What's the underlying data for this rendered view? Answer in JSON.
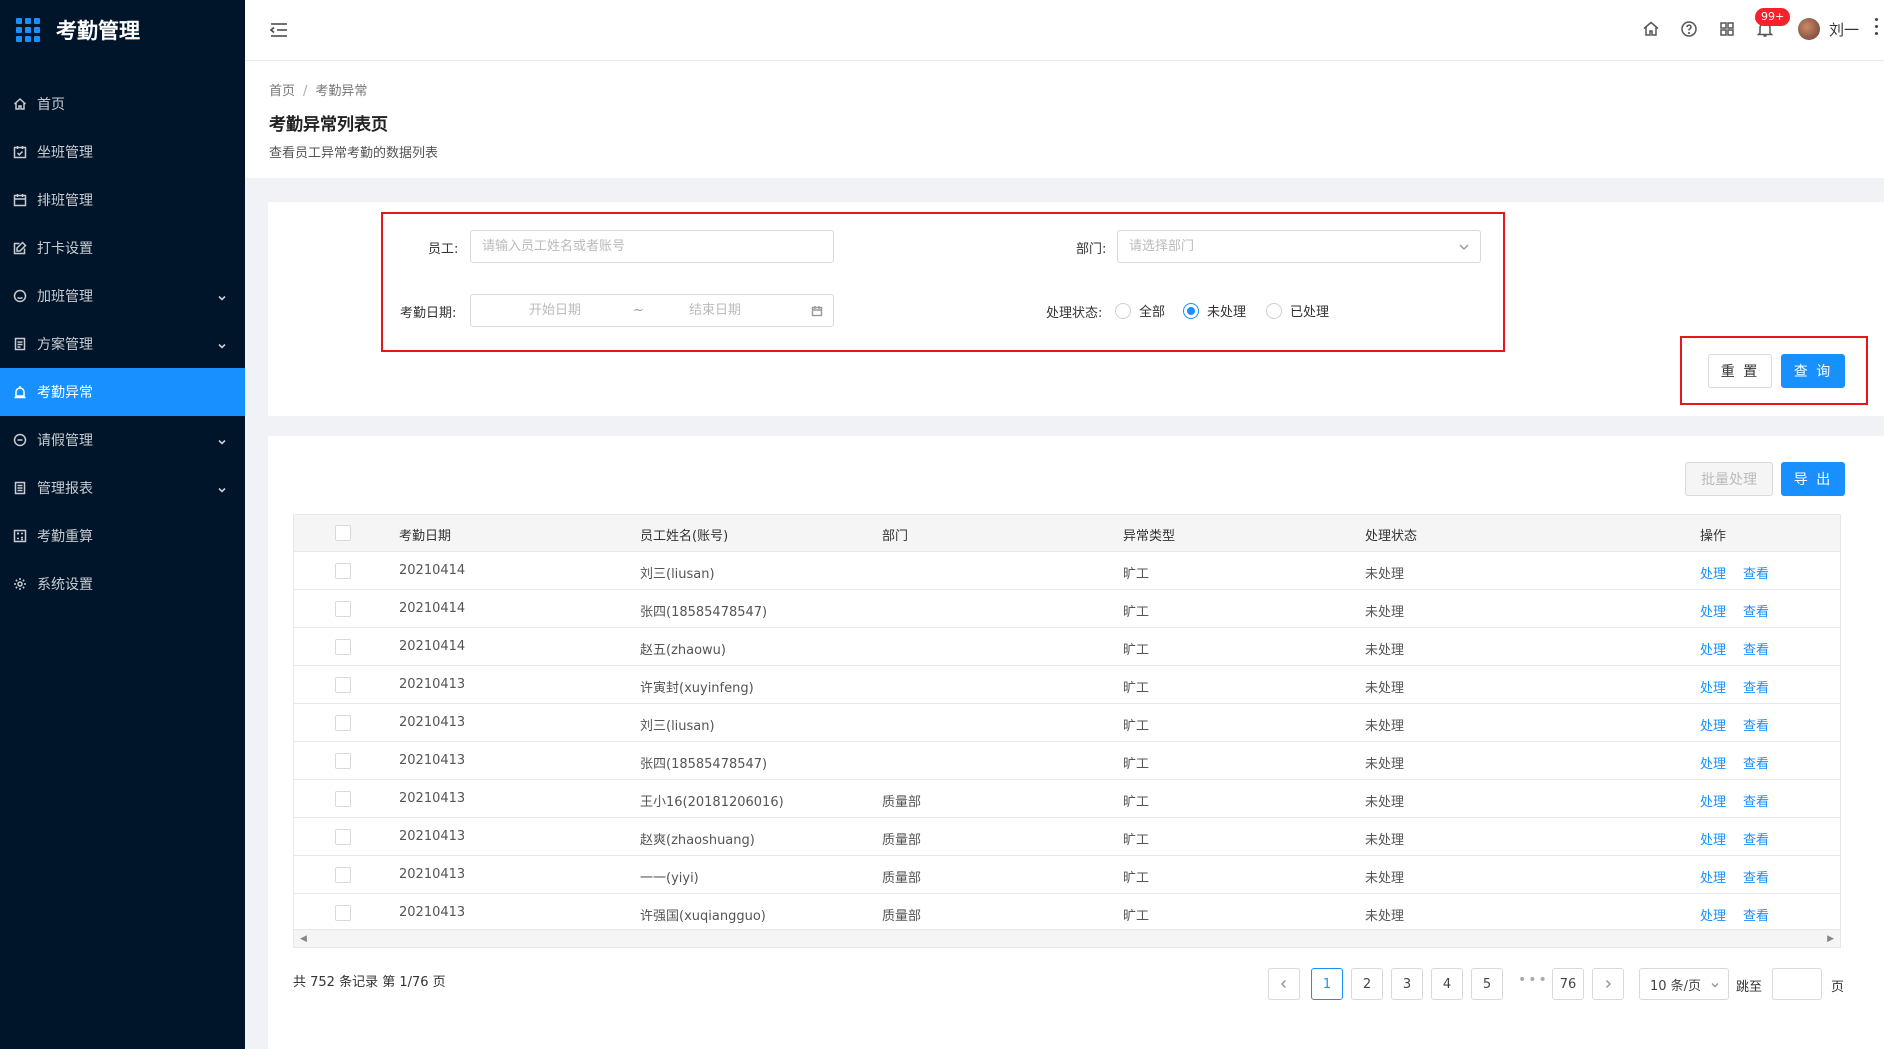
{
  "app": {
    "title": "考勤管理"
  },
  "sidebar": {
    "items": [
      {
        "label": "首页",
        "icon": "home-icon",
        "has_caret": false,
        "active": false
      },
      {
        "label": "坐班管理",
        "icon": "calendar-check-icon",
        "has_caret": false,
        "active": false
      },
      {
        "label": "排班管理",
        "icon": "calendar-icon",
        "has_caret": false,
        "active": false
      },
      {
        "label": "打卡设置",
        "icon": "edit-icon",
        "has_caret": false,
        "active": false
      },
      {
        "label": "加班管理",
        "icon": "clock-circle-icon",
        "has_caret": true,
        "active": false
      },
      {
        "label": "方案管理",
        "icon": "file-icon",
        "has_caret": true,
        "active": false
      },
      {
        "label": "考勤异常",
        "icon": "alert-icon",
        "has_caret": false,
        "active": true
      },
      {
        "label": "请假管理",
        "icon": "minus-circle-icon",
        "has_caret": true,
        "active": false
      },
      {
        "label": "管理报表",
        "icon": "report-icon",
        "has_caret": true,
        "active": false
      },
      {
        "label": "考勤重算",
        "icon": "calculator-icon",
        "has_caret": false,
        "active": false
      },
      {
        "label": "系统设置",
        "icon": "settings-icon",
        "has_caret": false,
        "active": false
      }
    ]
  },
  "header": {
    "badge": "99+",
    "user_name": "刘一"
  },
  "breadcrumb": {
    "home": "首页",
    "sep": "/",
    "current": "考勤异常"
  },
  "page": {
    "title": "考勤异常列表页",
    "description": "查看员工异常考勤的数据列表"
  },
  "filter": {
    "employee_label": "员工:",
    "employee_placeholder": "请输入员工姓名或者账号",
    "department_label": "部门:",
    "department_placeholder": "请选择部门",
    "date_label": "考勤日期:",
    "start_placeholder": "开始日期",
    "range_sep": "~",
    "end_placeholder": "结束日期",
    "status_label": "处理状态:",
    "status_options": [
      "全部",
      "未处理",
      "已处理"
    ],
    "status_selected": 1,
    "reset_label": "重 置",
    "search_label": "查 询"
  },
  "toolbar": {
    "batch_label": "批量处理",
    "export_label": "导 出"
  },
  "table": {
    "columns": [
      "考勤日期",
      "员工姓名(账号)",
      "部门",
      "异常类型",
      "处理状态",
      "操作"
    ],
    "rows": [
      {
        "date": "20210414",
        "name": "刘三(liusan)",
        "dept": "",
        "type": "旷工",
        "status": "未处理"
      },
      {
        "date": "20210414",
        "name": "张四(18585478547)",
        "dept": "",
        "type": "旷工",
        "status": "未处理"
      },
      {
        "date": "20210414",
        "name": "赵五(zhaowu)",
        "dept": "",
        "type": "旷工",
        "status": "未处理"
      },
      {
        "date": "20210413",
        "name": "许寅封(xuyinfeng)",
        "dept": "",
        "type": "旷工",
        "status": "未处理"
      },
      {
        "date": "20210413",
        "name": "刘三(liusan)",
        "dept": "",
        "type": "旷工",
        "status": "未处理"
      },
      {
        "date": "20210413",
        "name": "张四(18585478547)",
        "dept": "",
        "type": "旷工",
        "status": "未处理"
      },
      {
        "date": "20210413",
        "name": "王小16(20181206016)",
        "dept": "质量部",
        "type": "旷工",
        "status": "未处理"
      },
      {
        "date": "20210413",
        "name": "赵爽(zhaoshuang)",
        "dept": "质量部",
        "type": "旷工",
        "status": "未处理"
      },
      {
        "date": "20210413",
        "name": "一一(yiyi)",
        "dept": "质量部",
        "type": "旷工",
        "status": "未处理"
      },
      {
        "date": "20210413",
        "name": "许强国(xuqiangguo)",
        "dept": "质量部",
        "type": "旷工",
        "status": "未处理"
      }
    ],
    "action_process": "处理",
    "action_view": "查看"
  },
  "pagination": {
    "total_text": "共 752 条记录 第 1/76 页",
    "pages": [
      "1",
      "2",
      "3",
      "4",
      "5"
    ],
    "ellipsis": "•••",
    "last_page": "76",
    "current": "1",
    "page_size": "10 条/页",
    "jump_label": "跳至",
    "jump_suffix": "页"
  },
  "colors": {
    "sidebar_bg": "#001529",
    "accent": "#1890ff",
    "highlight_box": "#e8151d"
  }
}
